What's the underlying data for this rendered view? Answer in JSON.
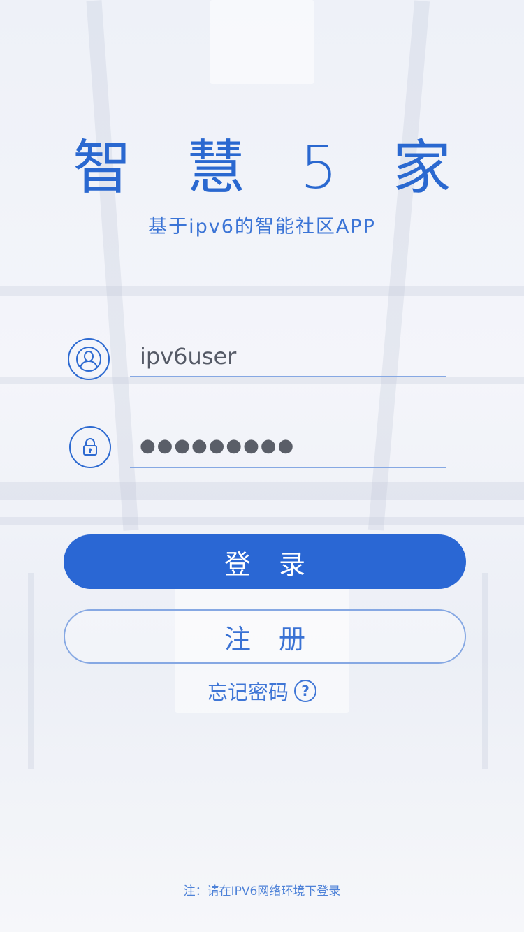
{
  "app": {
    "title": "智 慧 5 家",
    "subtitle": "基于ipv6的智能社区APP"
  },
  "login_form": {
    "username": {
      "icon": "user-circle-icon",
      "value": "ipv6user"
    },
    "password": {
      "icon": "lock-circle-icon",
      "value": "●●●●●●●●●"
    },
    "login_label": "登 录",
    "register_label": "注 册",
    "forgot_label": "忘记密码",
    "forgot_icon": "question-circle-icon"
  },
  "footer": {
    "note": "注：请在IPV6网络环境下登录"
  },
  "colors": {
    "accent": "#2a67d4",
    "outline": "#86a8e3",
    "background": "#eef1f8"
  }
}
